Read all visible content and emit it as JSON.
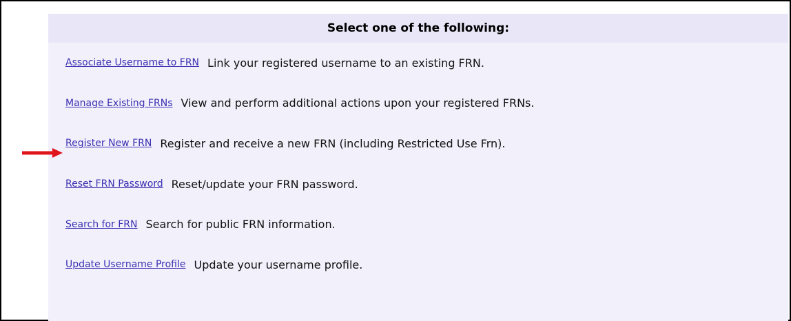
{
  "panel": {
    "heading": "Select one of the following:"
  },
  "options": [
    {
      "link": "Associate Username to FRN",
      "description": "Link your registered username to an existing FRN."
    },
    {
      "link": "Manage Existing FRNs",
      "description": "View and perform additional actions upon your registered FRNs."
    },
    {
      "link": "Register New FRN",
      "description": "Register and receive a new FRN (including Restricted Use Frn)."
    },
    {
      "link": "Reset FRN Password",
      "description": "Reset/update your FRN password."
    },
    {
      "link": "Search for FRN",
      "description": "Search for public FRN information."
    },
    {
      "link": "Update Username Profile",
      "description": "Update your username profile."
    }
  ],
  "annotation": {
    "icon": "arrow-right-icon",
    "color": "#e0141b"
  },
  "colors": {
    "link": "#3b2fb2",
    "panel_background": "#f2f1fb",
    "header_background": "#e9e7f7",
    "frame_border": "#000000"
  }
}
